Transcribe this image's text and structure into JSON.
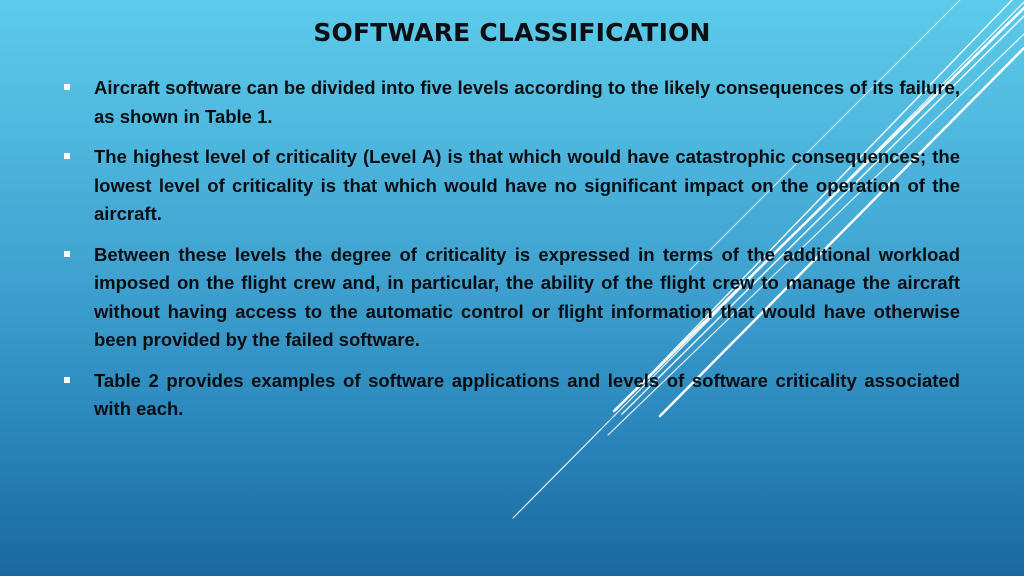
{
  "slide": {
    "title": "SOFTWARE CLASSIFICATION",
    "bullets": [
      {
        "text": "Aircraft software can be divided into five levels according to the likely consequences of its failure, as shown in Table 1."
      },
      {
        "text": "The highest level of criticality (Level A) is that which would have catastrophic consequences; the lowest level of criticality is that which would have no significant impact on the operation of the aircraft."
      },
      {
        "text": " Between these levels the degree of criticality is expressed in terms of the additional workload imposed on the flight crew and, in particular, the ability of the flight crew to manage the aircraft without having access to the automatic control  or flight information that would have otherwise been provided by the failed software."
      },
      {
        "text": "Table 2 provides examples of software applications and levels of software criticality associated with each."
      }
    ]
  },
  "theme": {
    "background_top": "#5ccbea",
    "background_bottom": "#1a68a0",
    "text_color": "#0a0e12",
    "bullet_color": "#ffffff",
    "decor_line_color": "#ffffff"
  }
}
